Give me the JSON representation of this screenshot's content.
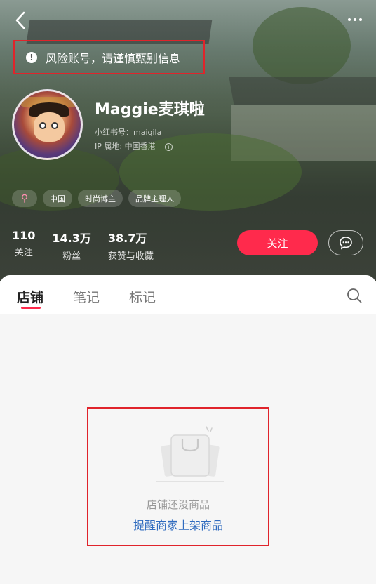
{
  "header": {
    "risk_notice": "风险账号，请谨慎甄别信息",
    "username": "Maggie麦琪啦",
    "xhs_id_label": "小红书号：maiqila",
    "ip_location": "IP 属地: 中国香港",
    "tags": [
      "♀",
      "中国",
      "时尚博主",
      "品牌主理人"
    ],
    "stats": [
      {
        "num": "110",
        "label": "关注"
      },
      {
        "num": "14.3万",
        "label": "粉丝"
      },
      {
        "num": "38.7万",
        "label": "获赞与收藏"
      }
    ],
    "follow_label": "关注"
  },
  "tabs": [
    "店铺",
    "笔记",
    "标记"
  ],
  "empty_state": {
    "message": "店铺还没商品",
    "action": "提醒商家上架商品"
  },
  "colors": {
    "accent": "#ff2a4c",
    "link": "#2f6bbf",
    "highlight_box": "#e0242b"
  },
  "icons": [
    "back-arrow-icon",
    "more-icon",
    "warning-icon",
    "info-icon",
    "chat-icon",
    "search-icon",
    "shopping-bag-icon"
  ]
}
